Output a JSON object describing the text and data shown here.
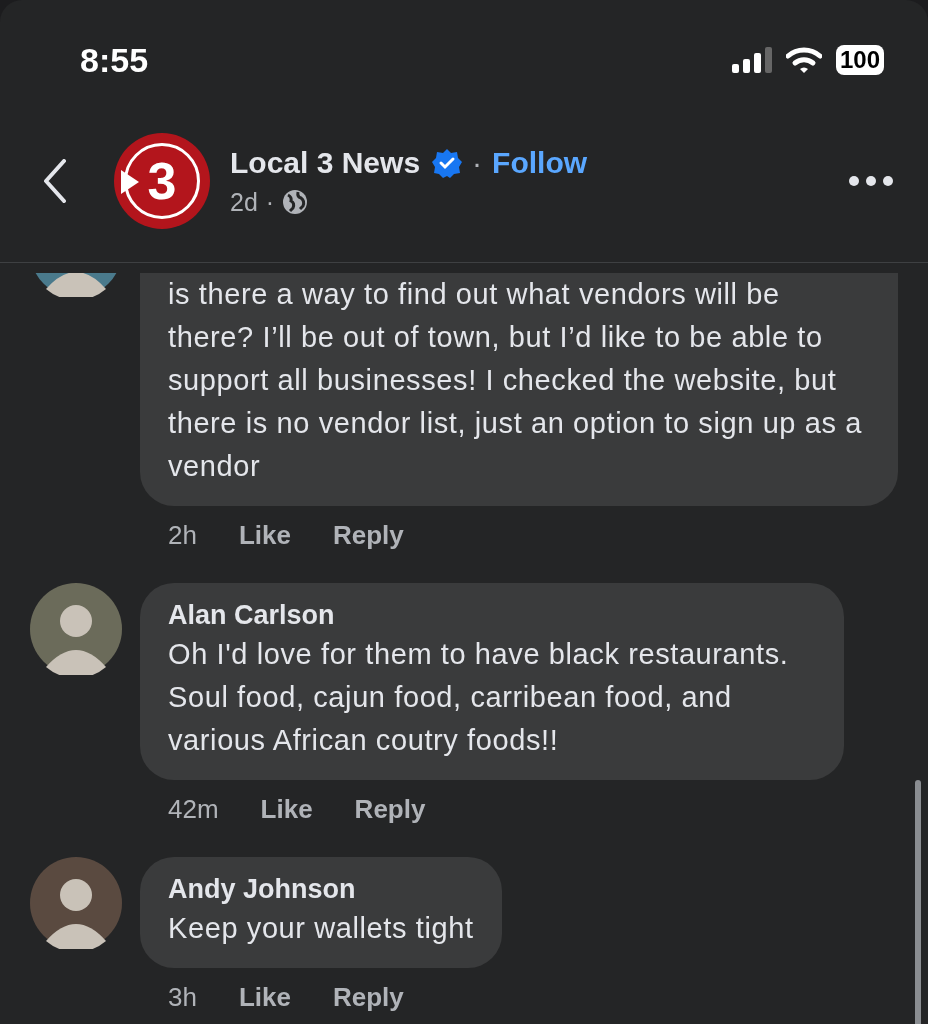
{
  "status_bar": {
    "time": "8:55",
    "battery": "100"
  },
  "header": {
    "logo_text": "3",
    "page_name": "Local 3 News",
    "verified": true,
    "separator": "·",
    "follow": "Follow",
    "age": "2d",
    "age_separator": "·"
  },
  "comments": [
    {
      "text": "is there a way to find out what vendors will be there? I’ll be out of town, but I’d like to be able to support all businesses! I checked the website, but there is no vendor list, just an option to sign up as a vendor",
      "time": "2h",
      "like": "Like",
      "reply": "Reply"
    },
    {
      "author": "Alan Carlson",
      "text": "Oh I'd love for them to have black restaurants. Soul food, cajun food, carribean food, and various African coutry foods!!",
      "time": "42m",
      "like": "Like",
      "reply": "Reply"
    },
    {
      "author": "Andy Johnson",
      "text": "Keep your wallets tight",
      "time": "3h",
      "like": "Like",
      "reply": "Reply"
    }
  ]
}
